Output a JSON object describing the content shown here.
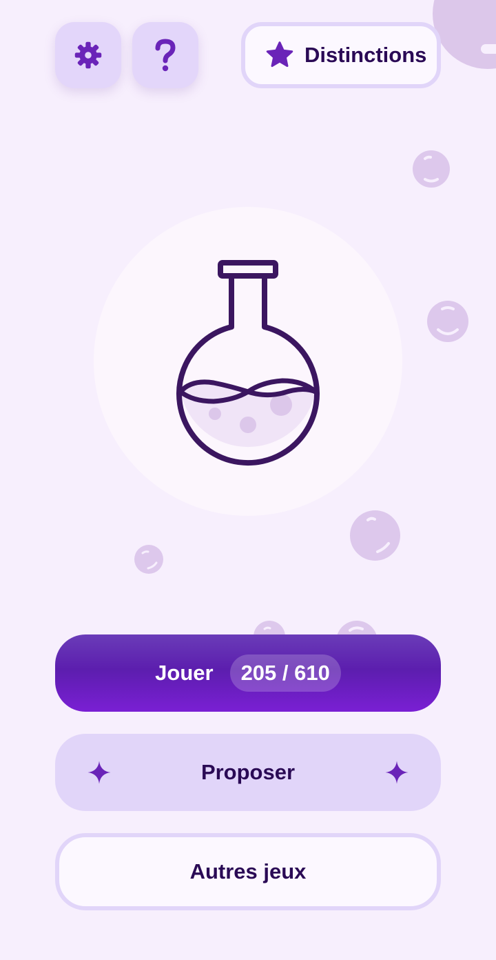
{
  "header": {
    "settings_icon": "gear-icon",
    "help_icon": "question-mark-icon",
    "distinctions_icon": "star-icon",
    "distinctions_label": "Distinctions"
  },
  "hero": {
    "icon": "flask-icon"
  },
  "actions": {
    "play_label": "Jouer",
    "play_progress": "205 / 610",
    "propose_label": "Proposer",
    "propose_icon": "sparkle-icon",
    "other_games_label": "Autres jeux"
  },
  "colors": {
    "background": "#f7effd",
    "accent": "#5c1eae",
    "accent_light": "#e1d5f9",
    "text_dark": "#2a0a55",
    "bubble": "#ddc8ec",
    "flask_outline": "#3b1660"
  }
}
